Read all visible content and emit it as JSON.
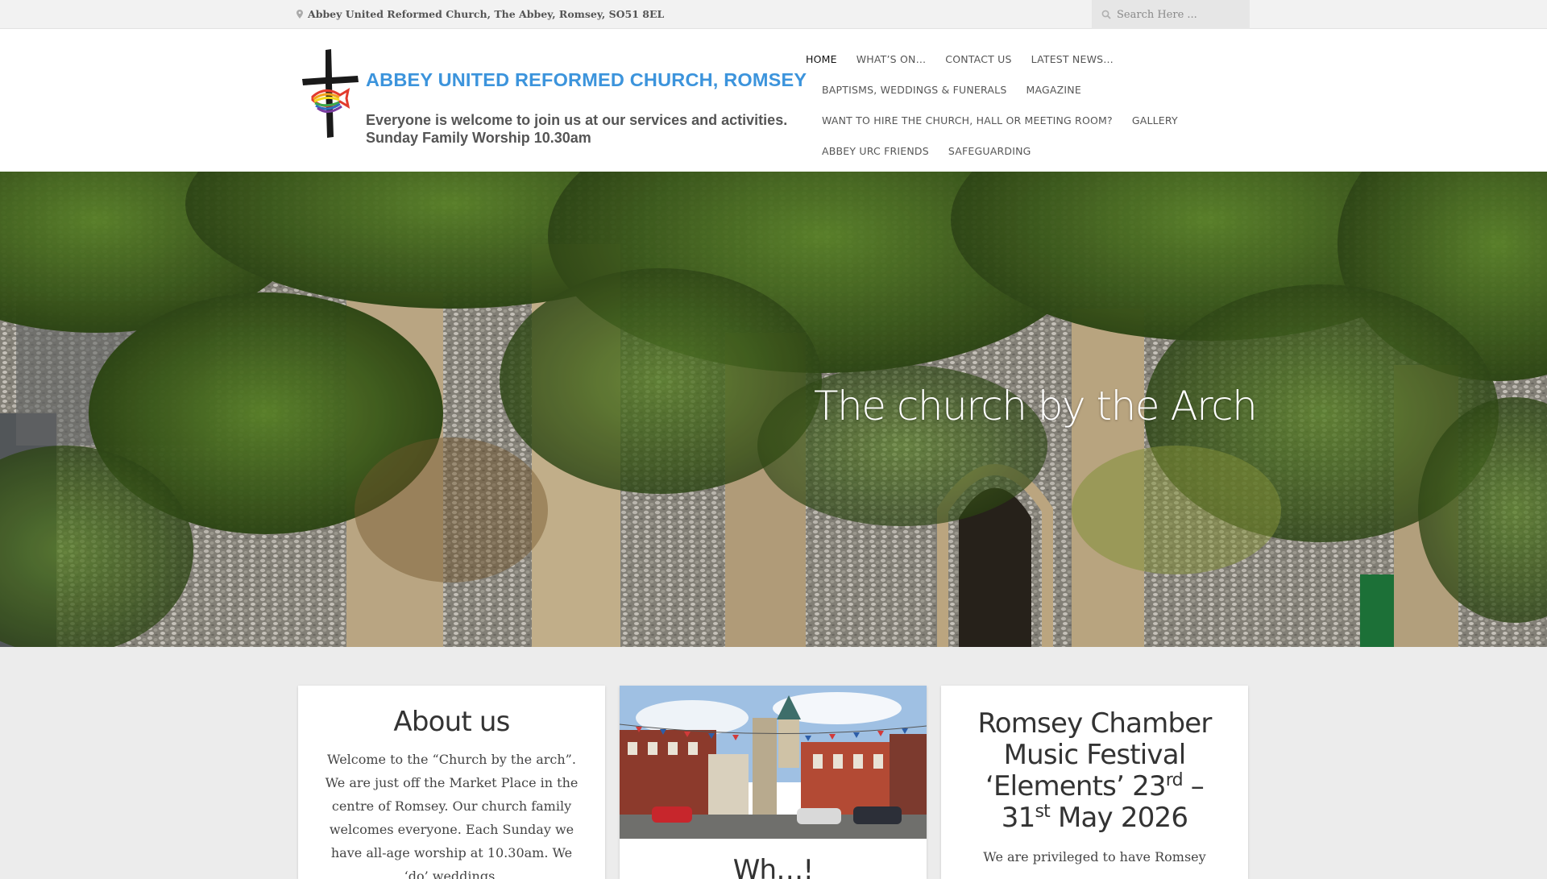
{
  "topbar": {
    "address": "Abbey United Reformed Church, The Abbey, Romsey, SO51 8EL",
    "search_placeholder": "Search Here ..."
  },
  "logo": {
    "title": "ABBEY UNITED REFORMED CHURCH, ROMSEY",
    "tagline_line1": "Everyone is welcome to join us at our services and activities.",
    "tagline_line2": "Sunday Family Worship 10.30am"
  },
  "nav": {
    "items": [
      {
        "label": "Home"
      },
      {
        "label": "What’s On…"
      },
      {
        "label": "Contact Us"
      },
      {
        "label": "Latest News…"
      },
      {
        "label": "Baptisms, Weddings & Funerals"
      },
      {
        "label": "Magazine"
      },
      {
        "label": "Want to hire the church, hall or meeting room?"
      },
      {
        "label": "Gallery"
      },
      {
        "label": "Abbey URC Friends"
      },
      {
        "label": "Safeguarding"
      }
    ],
    "active": "Home"
  },
  "hero": {
    "caption": "The church by the Arch"
  },
  "cards": {
    "about": {
      "title": "About us",
      "text": "Welcome to the “Church by the arch”. We are just off the Market Place in the centre of Romsey. Our church family welcomes everyone.  Each Sunday we have all-age worship at 10.30am. We ‘do’ weddings,"
    },
    "middle": {
      "title": "Wh…!"
    },
    "festival": {
      "title_main": "Romsey Chamber Music Festival ‘Elements’ 23",
      "title_sup1": "rd",
      "title_mid": " – 31",
      "title_sup2": "st",
      "title_end": " May 2026",
      "text": "We are privileged to have Romsey"
    }
  },
  "colors": {
    "brand_blue": "#3c94dc",
    "topbar_bg": "#f2f2f2",
    "page_bg": "#ececec"
  }
}
